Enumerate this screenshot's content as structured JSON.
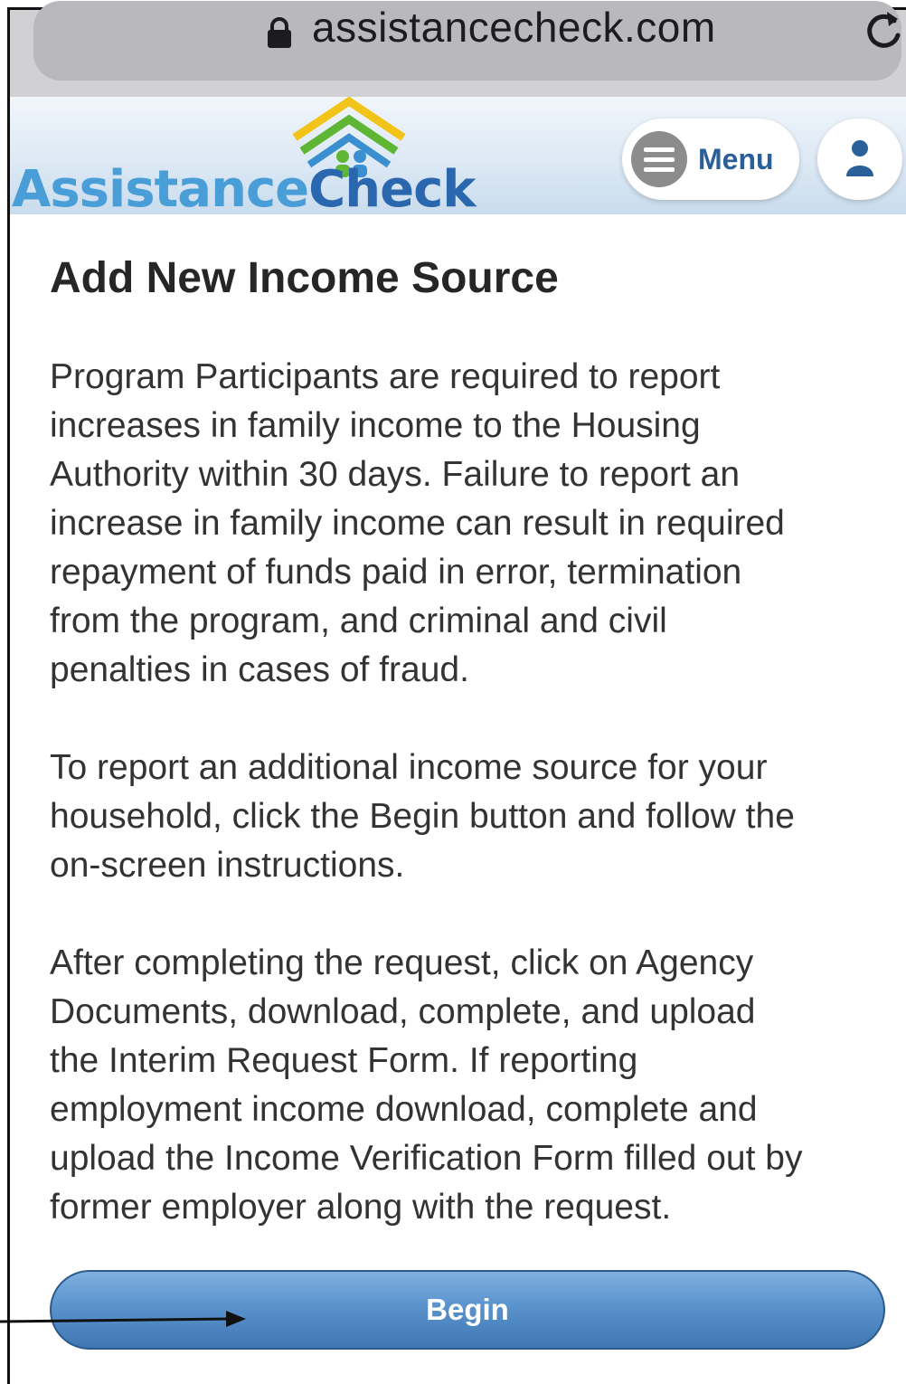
{
  "browser": {
    "url": "assistancecheck.com",
    "lock_icon": "lock-icon",
    "reload_icon": "reload-icon"
  },
  "header": {
    "logo_part1": "Assistance",
    "logo_part2": "Check",
    "menu_label": "Menu",
    "menu_icon": "hamburger-icon",
    "user_icon": "user-icon"
  },
  "main": {
    "title": "Add New Income Source",
    "paragraph_1": "Program Participants are required to report\nincreases in family income to the Housing\nAuthority within 30 days. Failure to report an\nincrease in family income can result in required\nrepayment of funds paid in error, termination\nfrom the program, and criminal and civil\npenalties in cases of fraud.",
    "paragraph_2": "To report an additional income source for your\nhousehold, click the Begin button and follow the\non-screen instructions.",
    "paragraph_3": "After completing the request, click on Agency\nDocuments, download, complete, and upload\nthe Interim Request Form. If reporting\nemployment income download, complete and\nupload the Income Verification Form filled out by\nformer employer along with the request.",
    "begin_label": "Begin"
  },
  "colors": {
    "logo_light": "#4a9ed8",
    "logo_dark": "#2b67ae",
    "button_blue": "#4f87c2",
    "menu_text": "#2b5f99"
  }
}
